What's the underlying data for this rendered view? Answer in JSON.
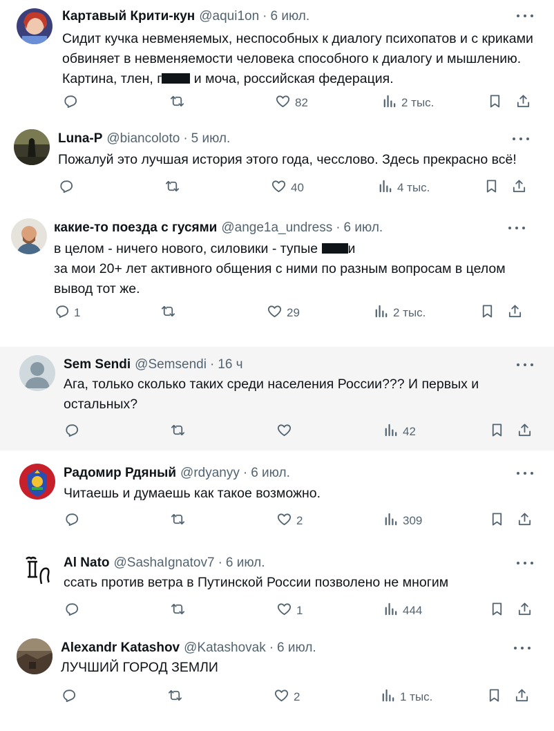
{
  "tweets": [
    {
      "author": "Картавый Крити-кун",
      "handle": "@aqui1on",
      "time": "6 июл.",
      "text_parts": [
        "Сидит кучка невменяемых, неспособных к диалогу психопатов и с криками обвиняет в невменяемости человека способного к диалогу и мышлению.\nКартина, тлен, г",
        " и моча, российская федерация."
      ],
      "counts": {
        "reply": "",
        "retweet": "",
        "like": "82",
        "views": "2 тыс."
      }
    },
    {
      "author": "Luna-P",
      "handle": "@biancoloto",
      "time": "5 июл.",
      "text_parts": [
        "Пожалуй это лучшая история этого года, чесслово. Здесь прекрасно всё!"
      ],
      "counts": {
        "reply": "",
        "retweet": "",
        "like": "40",
        "views": "4 тыс."
      }
    },
    {
      "author": "какие-то поезда с гусями",
      "handle": "@ange1a_undress",
      "time": "6 июл.",
      "text_parts": [
        "в целом - ничего нового, силовики - тупые ",
        "и\nза мои 20+ лет активного общения с ними по разным вопросам в целом вывод тот же."
      ],
      "counts": {
        "reply": "1",
        "retweet": "",
        "like": "29",
        "views": "2 тыс."
      }
    },
    {
      "author": "Sem Sendi",
      "handle": "@Semsendi",
      "time": "16 ч",
      "text_parts": [
        "Ага, только сколько таких среди населения России??? И первых и остальных?"
      ],
      "counts": {
        "reply": "",
        "retweet": "",
        "like": "",
        "views": "42"
      }
    },
    {
      "author": "Радомир Рдяный",
      "handle": "@rdyanyy",
      "time": "6 июл.",
      "text_parts": [
        "Читаешь и думаешь как такое возможно."
      ],
      "counts": {
        "reply": "",
        "retweet": "",
        "like": "2",
        "views": "309"
      }
    },
    {
      "author": "Al Nato",
      "handle": "@SashaIgnatov7",
      "time": "6 июл.",
      "text_parts": [
        "ссать против ветра в Путинской России позволено не многим"
      ],
      "counts": {
        "reply": "",
        "retweet": "",
        "like": "1",
        "views": "444"
      }
    },
    {
      "author": "Alexandr Katashov",
      "handle": "@Katashovak",
      "time": "6 июл.",
      "text_parts": [
        "ЛУЧШИЙ ГОРОД ЗЕМЛИ"
      ],
      "counts": {
        "reply": "",
        "retweet": "",
        "like": "2",
        "views": "1 тыс."
      }
    }
  ],
  "header_separator": "·",
  "icons": {
    "reply": "reply-icon",
    "retweet": "retweet-icon",
    "like": "like-icon",
    "views": "views-icon",
    "bookmark": "bookmark-icon",
    "share": "share-icon",
    "more": "more-icon"
  },
  "colors": {
    "text": "#0f1419",
    "secondary": "#536471",
    "highlight_bg": "#f5f5f5"
  }
}
